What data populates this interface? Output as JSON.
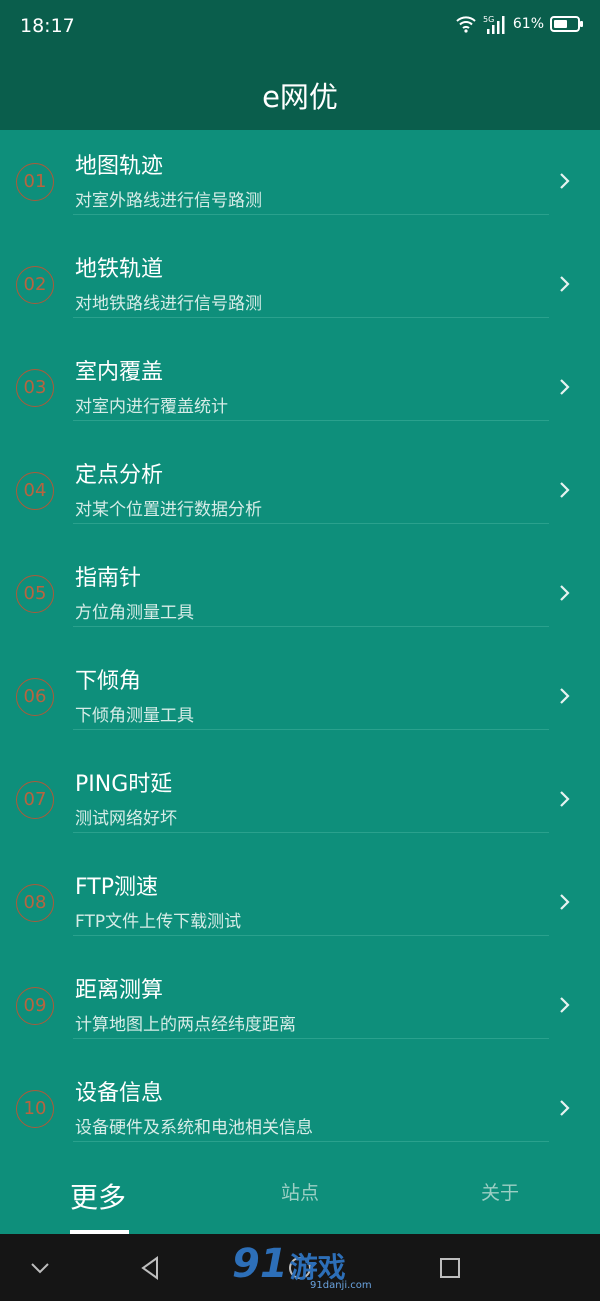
{
  "status_bar": {
    "time": "18:17",
    "network": "5G",
    "battery_level": "61%",
    "battery_fraction": 0.61,
    "icons": [
      "wifi-icon",
      "signal-icon",
      "battery-icon"
    ]
  },
  "header": {
    "title": "e网优"
  },
  "menu": {
    "items": [
      {
        "num": "01",
        "title": "地图轨迹",
        "subtitle": "对室外路线进行信号路测"
      },
      {
        "num": "02",
        "title": "地铁轨道",
        "subtitle": "对地铁路线进行信号路测"
      },
      {
        "num": "03",
        "title": "室内覆盖",
        "subtitle": "对室内进行覆盖统计"
      },
      {
        "num": "04",
        "title": "定点分析",
        "subtitle": "对某个位置进行数据分析"
      },
      {
        "num": "05",
        "title": "指南针",
        "subtitle": "方位角测量工具"
      },
      {
        "num": "06",
        "title": "下倾角",
        "subtitle": "下倾角测量工具"
      },
      {
        "num": "07",
        "title": "PING时延",
        "subtitle": "测试网络好坏"
      },
      {
        "num": "08",
        "title": "FTP测速",
        "subtitle": "FTP文件上传下载测试"
      },
      {
        "num": "09",
        "title": "距离测算",
        "subtitle": "计算地图上的两点经纬度距离"
      },
      {
        "num": "10",
        "title": "设备信息",
        "subtitle": "设备硬件及系统和电池相关信息"
      }
    ]
  },
  "tabs": {
    "items": [
      {
        "label": "更多",
        "active": true
      },
      {
        "label": "站点",
        "active": false
      },
      {
        "label": "关于",
        "active": false
      }
    ]
  },
  "navbar": {
    "icons": [
      "chevron-down-icon",
      "back-icon",
      "home-icon",
      "recents-icon"
    ]
  },
  "watermark": {
    "logo": "91",
    "text": "游戏",
    "url": "91danji.com"
  },
  "colors": {
    "background": "#0e8f7b",
    "header": "#0a5e4c",
    "badge": "#b76440",
    "navbar": "#151515"
  }
}
